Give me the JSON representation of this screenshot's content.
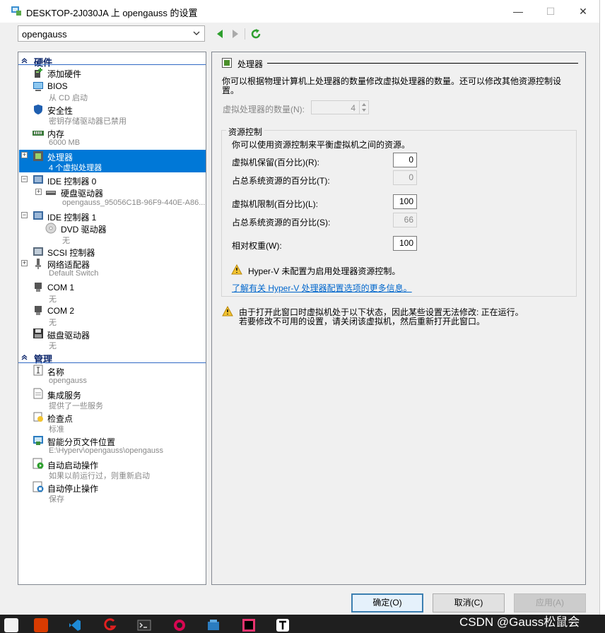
{
  "window": {
    "title": "DESKTOP-2J030JA 上 opengauss 的设置",
    "minimize": "—",
    "maximize": "☐",
    "close": "✕"
  },
  "vm_select": {
    "value": "opengauss"
  },
  "hardware_section": "硬件",
  "management_section": "管理",
  "hardware_items": [
    {
      "label": "添加硬件",
      "sub": ""
    },
    {
      "label": "BIOS",
      "sub": "从 CD 启动"
    },
    {
      "label": "安全性",
      "sub": "密钥存储驱动器已禁用"
    },
    {
      "label": "内存",
      "sub": "6000 MB"
    },
    {
      "label": "处理器",
      "sub": "4 个虚拟处理器"
    },
    {
      "label": "IDE 控制器 0",
      "sub": ""
    },
    {
      "label": "硬盘驱动器",
      "sub": "opengauss_95056C1B-96F9-440E-A86..."
    },
    {
      "label": "IDE 控制器 1",
      "sub": ""
    },
    {
      "label": "DVD 驱动器",
      "sub": "无"
    },
    {
      "label": "SCSI 控制器",
      "sub": ""
    },
    {
      "label": "网络适配器",
      "sub": "Default Switch"
    },
    {
      "label": "COM 1",
      "sub": "无"
    },
    {
      "label": "COM 2",
      "sub": "无"
    },
    {
      "label": "磁盘驱动器",
      "sub": "无"
    }
  ],
  "management_items": [
    {
      "label": "名称",
      "sub": "opengauss"
    },
    {
      "label": "集成服务",
      "sub": "提供了一些服务"
    },
    {
      "label": "检查点",
      "sub": "标准"
    },
    {
      "label": "智能分页文件位置",
      "sub": "E:\\Hyperv\\opengauss\\opengauss"
    },
    {
      "label": "自动启动操作",
      "sub": "如果以前运行过，则重新启动"
    },
    {
      "label": "自动停止操作",
      "sub": "保存"
    }
  ],
  "processor": {
    "heading": "处理器",
    "description": "你可以根据物理计算机上处理器的数量修改虚拟处理器的数量。还可以修改其他资源控制设置。",
    "vcpu_label": "虚拟处理器的数量(N):",
    "vcpu_value": "4",
    "resource_group": "资源控制",
    "resource_desc": "你可以使用资源控制来平衡虚拟机之间的资源。",
    "reserve_label": "虚拟机保留(百分比)(R):",
    "reserve_value": "0",
    "reserve_total_label": "占总系统资源的百分比(T):",
    "reserve_total_value": "0",
    "limit_label": "虚拟机限制(百分比)(L):",
    "limit_value": "100",
    "limit_total_label": "占总系统资源的百分比(S):",
    "limit_total_value": "66",
    "weight_label": "相对权重(W):",
    "weight_value": "100",
    "hyperv_warning": "Hyper-V 未配置为启用处理器资源控制。",
    "learn_more": "了解有关 Hyper-V 处理器配置选项的更多信息。",
    "running_warning_1": "由于打开此窗口时虚拟机处于以下状态，因此某些设置无法修改: 正在运行。",
    "running_warning_2": "若要修改不可用的设置，请关闭该虚拟机，然后重新打开此窗口。"
  },
  "buttons": {
    "ok": "确定(O)",
    "cancel": "取消(C)",
    "apply": "应用(A)"
  },
  "watermark": "CSDN @Gauss松鼠会",
  "colors": {
    "selection": "#0078d7",
    "link": "#0066cc",
    "accent_border": "#3c7fb1"
  }
}
